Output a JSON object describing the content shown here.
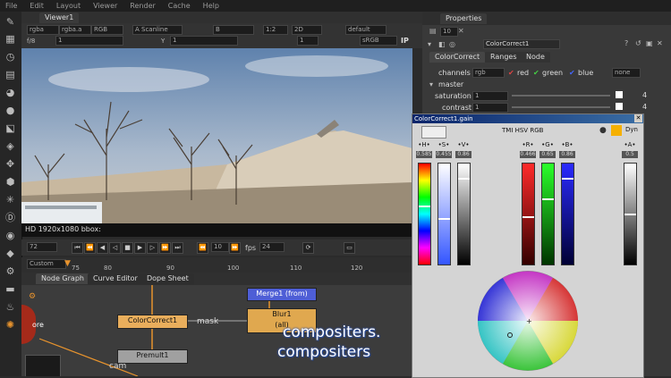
{
  "menubar": [
    "File",
    "Edit",
    "Layout",
    "Viewer",
    "Render",
    "Cache",
    "Help"
  ],
  "viewer": {
    "tab": "Viewer1",
    "channel_a": "rgba",
    "channel_b": "rgba.a",
    "colorspace": "RGB",
    "input_a": "A Scanline",
    "input_b": "B",
    "proxy": "1:2",
    "view_mode": "2D",
    "lut": "default",
    "fstop_label": "f/8",
    "fstop": "1",
    "y_label": "Y",
    "y_value": "1",
    "frame_field": "1",
    "srgb": "sRGB",
    "ip": "IP",
    "info": "HD 1920x1080 bbox:"
  },
  "transport": {
    "frame": "72",
    "step": "10",
    "fps_label": "fps",
    "fps": "24",
    "range_mode": "Custom",
    "ticks": [
      "75",
      "80",
      "90",
      "100",
      "110",
      "120"
    ]
  },
  "node_graph": {
    "tabs": [
      "Node Graph",
      "Curve Editor",
      "Dope Sheet"
    ],
    "nodes": {
      "merge": "Merge1 (from)",
      "blur": "Blur1",
      "blur_sub": "(all)",
      "colorcorrect": "ColorCorrect1",
      "premult": "Premult1",
      "mask_label": "mask",
      "cam_label": "cam",
      "read_label": "ore"
    }
  },
  "properties": {
    "tab": "Properties",
    "count": "10",
    "node_name": "ColorCorrect1",
    "tabs": [
      "ColorCorrect",
      "Ranges",
      "Node"
    ],
    "channels_label": "channels",
    "channels_value": "rgb",
    "ch_red": "red",
    "ch_green": "green",
    "ch_blue": "blue",
    "ch_none": "none",
    "master_label": "master",
    "saturation_label": "saturation",
    "saturation_value": "1",
    "contrast_label": "contrast",
    "contrast_value": "1",
    "swatch_count": "4"
  },
  "gain_panel": {
    "title": "ColorCorrect1.gain",
    "mode_label": "TMI HSV RGB",
    "dyn": "Dyn",
    "groups": [
      {
        "label": "H",
        "value": "0.585",
        "level": 0.58
      },
      {
        "label": "S",
        "value": "0.455",
        "level": 0.45
      },
      {
        "label": "V",
        "value": "0.86",
        "level": 0.86
      },
      {
        "label": "R",
        "value": "0.466",
        "level": 0.47
      },
      {
        "label": "G",
        "value": "0.65",
        "level": 0.65
      },
      {
        "label": "B",
        "value": "0.86",
        "level": 0.86
      },
      {
        "label": "A",
        "value": "0.5",
        "level": 0.5
      }
    ]
  },
  "captions": [
    "compositers.",
    "compositers"
  ],
  "colors": {
    "accent": "#e7932d",
    "node_cc": "#e9ae5c",
    "node_merge": "#4e5ed6",
    "node_blur": "#e0a84f",
    "node_premult": "#a0a0a0"
  }
}
